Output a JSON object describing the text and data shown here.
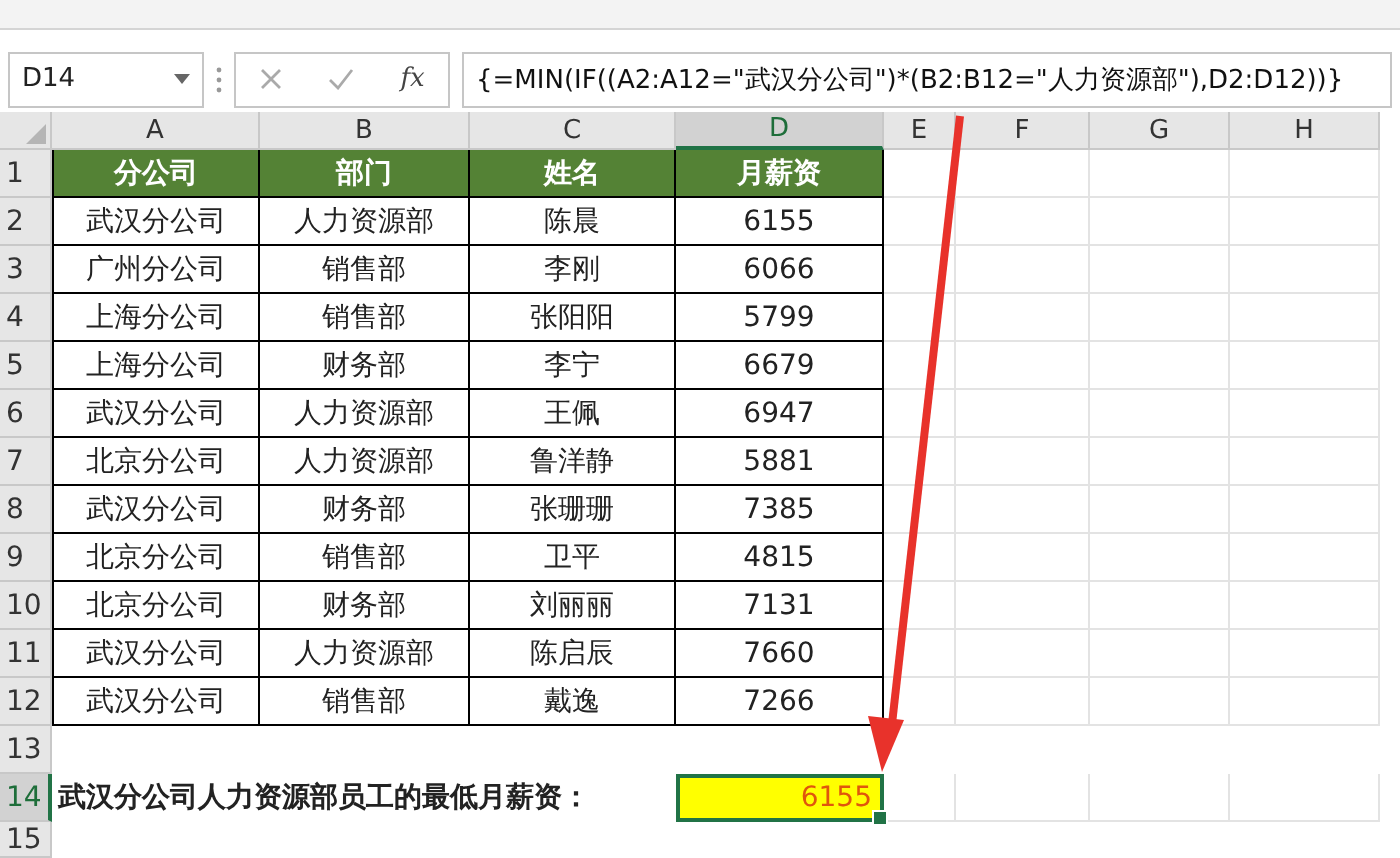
{
  "formula_bar": {
    "name_box": "D14",
    "function_label": "fx",
    "formula": "{=MIN(IF((A2:A12=\"武汉分公司\")*(B2:B12=\"人力资源部\"),D2:D12))}"
  },
  "columns": [
    {
      "label": "A",
      "selected": false
    },
    {
      "label": "B",
      "selected": false
    },
    {
      "label": "C",
      "selected": false
    },
    {
      "label": "D",
      "selected": true
    },
    {
      "label": "E",
      "selected": false
    },
    {
      "label": "F",
      "selected": false
    },
    {
      "label": "G",
      "selected": false
    },
    {
      "label": "H",
      "selected": false
    }
  ],
  "rows": [
    {
      "number": "1",
      "selected": false,
      "kind": "header",
      "cells": [
        "分公司",
        "部门",
        "姓名",
        "月薪资"
      ]
    },
    {
      "number": "2",
      "selected": false,
      "kind": "data",
      "cells": [
        "武汉分公司",
        "人力资源部",
        "陈晨",
        "6155"
      ]
    },
    {
      "number": "3",
      "selected": false,
      "kind": "data",
      "cells": [
        "广州分公司",
        "销售部",
        "李刚",
        "6066"
      ]
    },
    {
      "number": "4",
      "selected": false,
      "kind": "data",
      "cells": [
        "上海分公司",
        "销售部",
        "张阳阳",
        "5799"
      ]
    },
    {
      "number": "5",
      "selected": false,
      "kind": "data",
      "cells": [
        "上海分公司",
        "财务部",
        "李宁",
        "6679"
      ]
    },
    {
      "number": "6",
      "selected": false,
      "kind": "data",
      "cells": [
        "武汉分公司",
        "人力资源部",
        "王佩",
        "6947"
      ]
    },
    {
      "number": "7",
      "selected": false,
      "kind": "data",
      "cells": [
        "北京分公司",
        "人力资源部",
        "鲁洋静",
        "5881"
      ]
    },
    {
      "number": "8",
      "selected": false,
      "kind": "data",
      "cells": [
        "武汉分公司",
        "财务部",
        "张珊珊",
        "7385"
      ]
    },
    {
      "number": "9",
      "selected": false,
      "kind": "data",
      "cells": [
        "北京分公司",
        "销售部",
        "卫平",
        "4815"
      ]
    },
    {
      "number": "10",
      "selected": false,
      "kind": "data",
      "cells": [
        "北京分公司",
        "财务部",
        "刘丽丽",
        "7131"
      ]
    },
    {
      "number": "11",
      "selected": false,
      "kind": "data",
      "cells": [
        "武汉分公司",
        "人力资源部",
        "陈启辰",
        "7660"
      ]
    },
    {
      "number": "12",
      "selected": false,
      "kind": "data",
      "cells": [
        "武汉分公司",
        "销售部",
        "戴逸",
        "7266"
      ]
    },
    {
      "number": "13",
      "selected": false,
      "kind": "empty"
    },
    {
      "number": "14",
      "selected": true,
      "kind": "result",
      "label": "武汉分公司人力资源部员工的最低月薪资：",
      "value": "6155"
    },
    {
      "number": "15",
      "selected": false,
      "kind": "empty"
    }
  ]
}
